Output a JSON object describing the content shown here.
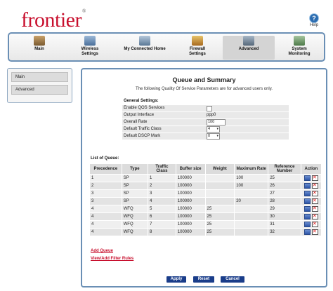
{
  "brand": {
    "logo_text": "frontier",
    "tm": "®"
  },
  "help": {
    "label": "Help",
    "glyph": "?"
  },
  "tabs": [
    {
      "label": "Main",
      "icon": "home-icon"
    },
    {
      "label": "Wireless Settings",
      "icon": "wireless-icon"
    },
    {
      "label": "My Connected Home",
      "icon": "network-icon"
    },
    {
      "label": "Firewall Settings",
      "icon": "firewall-icon"
    },
    {
      "label": "Advanced",
      "icon": "advanced-icon",
      "active": true
    },
    {
      "label": "System Monitoring",
      "icon": "monitor-icon"
    }
  ],
  "sidebar": {
    "items": [
      {
        "label": "Main"
      },
      {
        "label": "Advanced"
      }
    ]
  },
  "page": {
    "title": "Queue and Summary",
    "subtitle": "The following Quality Of Service Parameters are for advanced users only.",
    "general_heading": "General Settings:",
    "general": {
      "enable_qos_label": "Enable QOS Services",
      "output_interface_label": "Output Interface",
      "output_interface_value": "ppp0",
      "overall_rate_label": "Overall Rate",
      "overall_rate_value": "100",
      "default_traffic_class_label": "Default Traffic Class",
      "default_traffic_class_value": "4",
      "default_dscp_mark_label": "Default DSCP Mark",
      "default_dscp_mark_value": "0"
    },
    "queue_heading": "List of Queue:",
    "columns": {
      "precedence": "Precedence",
      "type": "Type",
      "traffic_class": "Traffic Class",
      "buffer_size": "Buffer size",
      "weight": "Weight",
      "max_rate": "Maximum Rate",
      "ref_number": "Reference Number",
      "action": "Action"
    },
    "rows": [
      {
        "precedence": "1",
        "type": "SP",
        "traffic_class": "1",
        "buffer_size": "100000",
        "weight": "",
        "max_rate": "100",
        "ref_number": "25"
      },
      {
        "precedence": "2",
        "type": "SP",
        "traffic_class": "2",
        "buffer_size": "100000",
        "weight": "",
        "max_rate": "100",
        "ref_number": "26"
      },
      {
        "precedence": "3",
        "type": "SP",
        "traffic_class": "3",
        "buffer_size": "100000",
        "weight": "",
        "max_rate": "",
        "ref_number": "27"
      },
      {
        "precedence": "3",
        "type": "SP",
        "traffic_class": "4",
        "buffer_size": "100000",
        "weight": "",
        "max_rate": "20",
        "ref_number": "28"
      },
      {
        "precedence": "4",
        "type": "WFQ",
        "traffic_class": "5",
        "buffer_size": "100000",
        "weight": "25",
        "max_rate": "",
        "ref_number": "29"
      },
      {
        "precedence": "4",
        "type": "WFQ",
        "traffic_class": "6",
        "buffer_size": "100000",
        "weight": "25",
        "max_rate": "",
        "ref_number": "30"
      },
      {
        "precedence": "4",
        "type": "WFQ",
        "traffic_class": "7",
        "buffer_size": "100000",
        "weight": "25",
        "max_rate": "",
        "ref_number": "31"
      },
      {
        "precedence": "4",
        "type": "WFQ",
        "traffic_class": "8",
        "buffer_size": "100000",
        "weight": "25",
        "max_rate": "",
        "ref_number": "32"
      }
    ],
    "add_queue_label": "Add Queue",
    "view_filter_label": "View/Add Filter Rules",
    "buttons": {
      "apply": "Apply",
      "reset": "Reset",
      "cancel": "Cancel"
    }
  },
  "colors": {
    "brand_red": "#c8102e",
    "nav_border": "#6a8fb5",
    "button_blue": "#1a3d8a"
  }
}
